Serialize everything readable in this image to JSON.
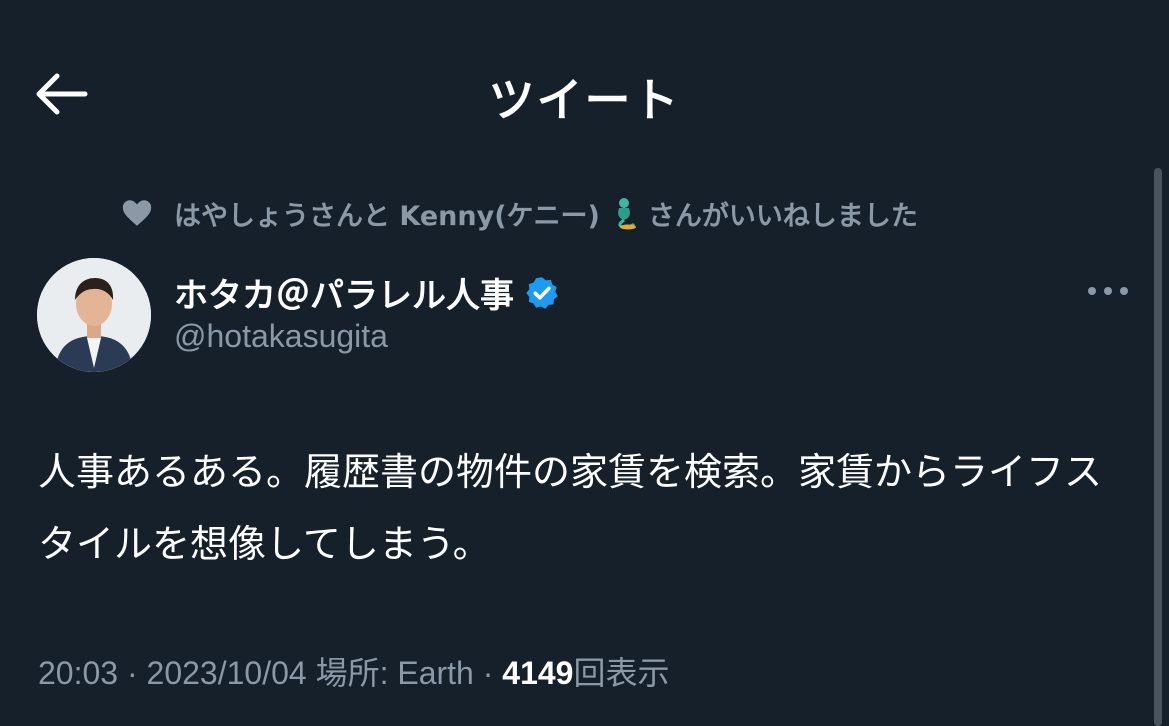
{
  "header": {
    "title": "ツイート"
  },
  "social_context": {
    "text_before": "はやしょうさんと Kenny(ケニー)",
    "text_after": "さんがいいねしました"
  },
  "author": {
    "name": "ホタカ＠パラレル人事",
    "handle": "@hotakasugita",
    "verified": true
  },
  "tweet": {
    "text": "人事あるある。履歴書の物件の家賃を検索。家賃からライフスタイルを想像してしまう。"
  },
  "meta": {
    "time": "20:03",
    "sep1": " · ",
    "date": "2023/10/04",
    "location_label": " 場所: Earth",
    "sep2": " · ",
    "views_count": "4149",
    "views_label": "回表示"
  },
  "colors": {
    "background": "#15202b",
    "secondary_text": "#8b98a5",
    "verified_badge": "#1d9bf0"
  },
  "icons": [
    "arrow-left-icon",
    "heart-icon",
    "genie-emoji-icon",
    "verified-badge-icon",
    "more-icon"
  ]
}
